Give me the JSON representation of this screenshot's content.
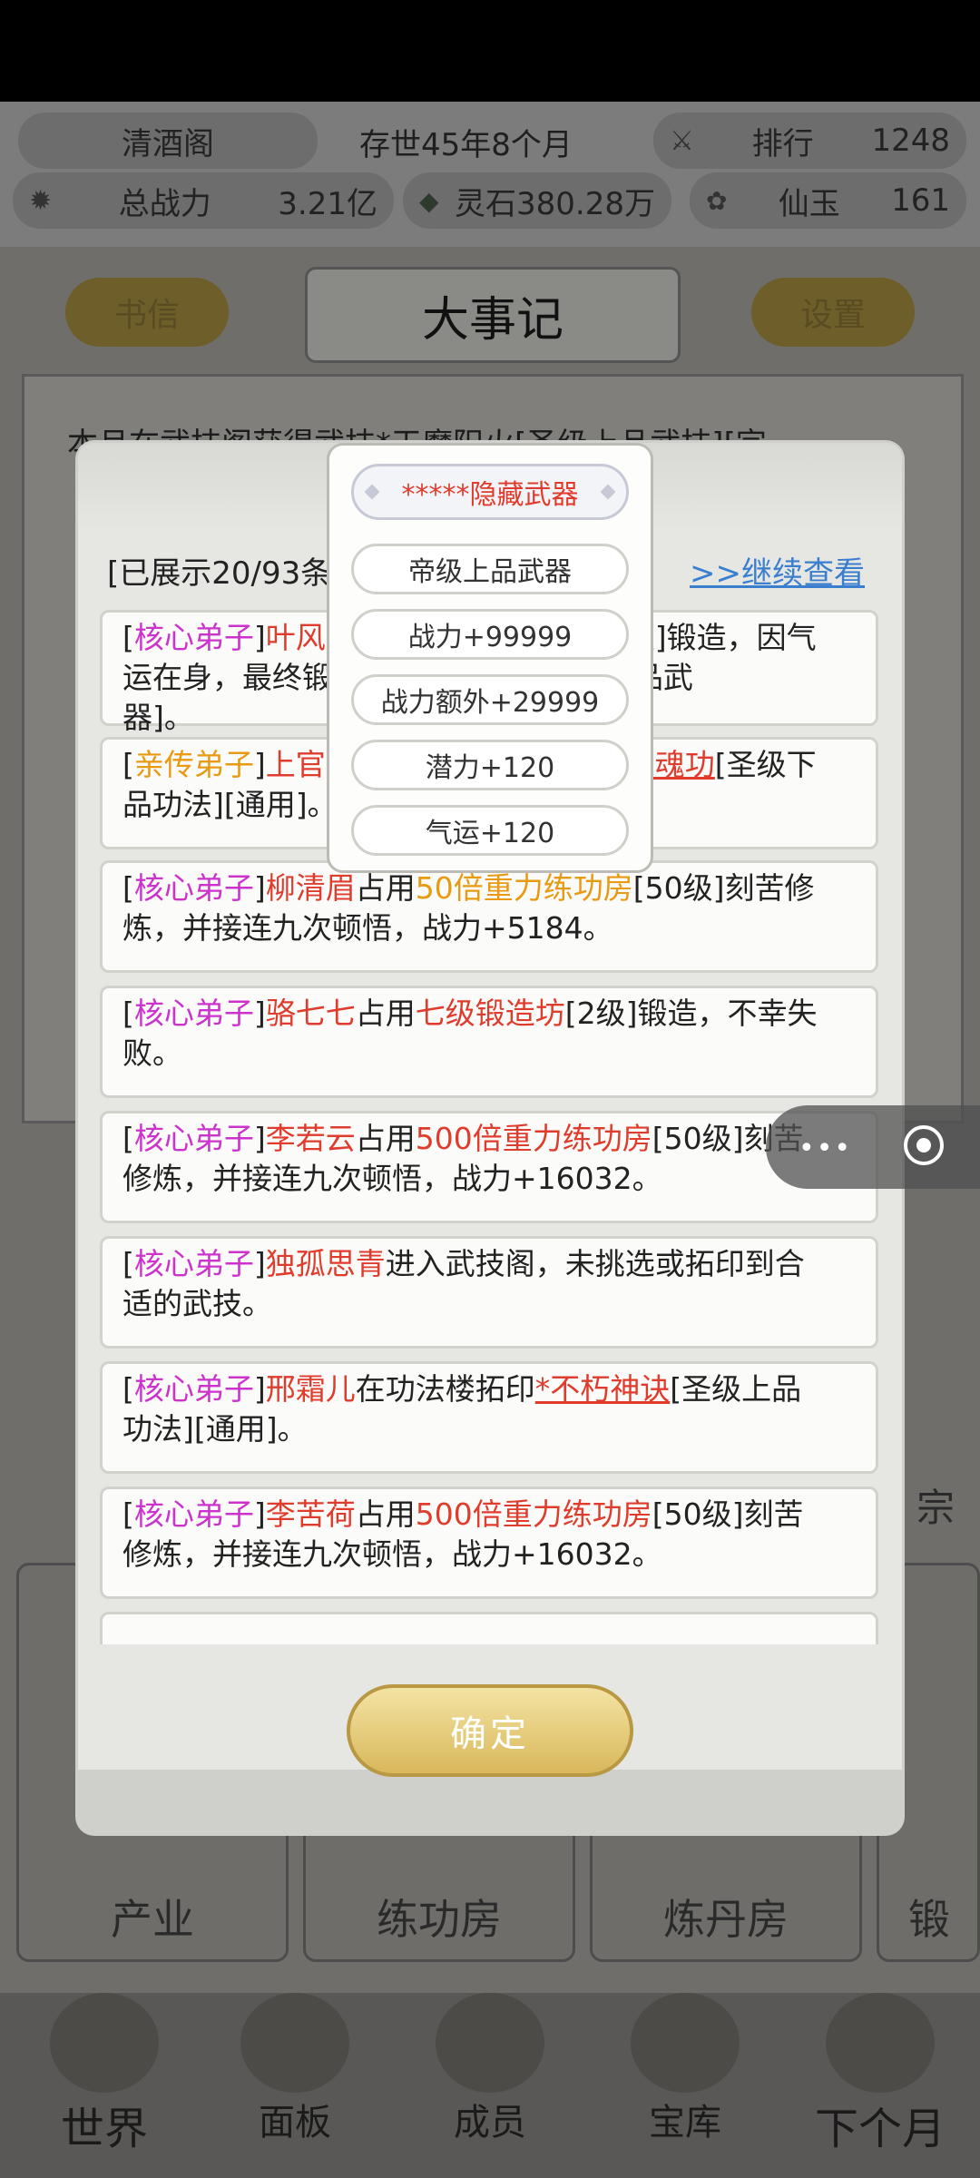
{
  "top": {
    "sect_name": "清酒阁",
    "existence": "存世45年8个月",
    "rank_label": "排行",
    "rank_value": "1248",
    "power_label": "总战力",
    "power_value": "3.21亿",
    "spirit_stone": "灵石380.28万",
    "immortal_jade_label": "仙玉",
    "immortal_jade_value": "161"
  },
  "header": {
    "letters_button": "书信",
    "title": "大事记",
    "settings_button": "设置"
  },
  "background": {
    "event_line1": "本月在武技阁获得武技*天魔阳火[圣级上品武技][宗",
    "side_char": "宗"
  },
  "facilities": [
    "产业",
    "练功房",
    "炼丹房",
    "锻"
  ],
  "nav": [
    "世界",
    "面板",
    "成员",
    "宝库",
    "下个月"
  ],
  "dialog": {
    "counter": "[已展示20/93条",
    "more_link": ">>继续查看",
    "confirm": "确定",
    "entries": [
      {
        "role": "核心弟子",
        "name": "叶风",
        "tail_a": "级]锻造，因气",
        "line2": "运在身，最终锻",
        "line2b": "[帝级上品武",
        "line3": "器]。"
      },
      {
        "role": "亲传弟子",
        "name": "上官",
        "item": "炼魂功",
        "tail_a": "[圣级下",
        "line2": "品功法][通用]。"
      },
      {
        "role": "核心弟子",
        "name": "柳清眉",
        "mid": "占用",
        "facility": "50倍重力练功房",
        "tail_a": "[50级]刻苦修",
        "line2": "炼，并接连九次顿悟，战力+5184。"
      },
      {
        "role": "核心弟子",
        "name": "骆七七",
        "mid": "占用",
        "facility": "七级锻造坊",
        "tail_a": "[2级]锻造，不幸失",
        "line2": "败。"
      },
      {
        "role": "核心弟子",
        "name": "李若云",
        "mid": "占用",
        "facility": "500倍重力练功房",
        "tail_a": "[50级]刻苦",
        "line2": "修炼，并接连九次顿悟，战力+16032。"
      },
      {
        "role": "核心弟子",
        "name": "独孤思青",
        "tail_a": "进入武技阁，未挑选或拓印到合",
        "line2": "适的武技。"
      },
      {
        "role": "核心弟子",
        "name": "邢霜儿",
        "mid": "在功法楼拓印",
        "item": "*不朽神诀",
        "tail_a": "[圣级上品",
        "line2": "功法][通用]。"
      },
      {
        "role": "核心弟子",
        "name": "李苦荷",
        "mid": "占用",
        "facility": "500倍重力练功房",
        "tail_a": "[50级]刻苦",
        "line2": "修炼，并接连九次顿悟，战力+16032。"
      }
    ]
  },
  "popup": {
    "name": "*****隐藏武器",
    "grade": "帝级上品武器",
    "power": "战力+99999",
    "extra_power": "战力额外+29999",
    "potential": "潜力+120",
    "luck": "气运+120"
  },
  "colors": {
    "core_disciple": "#cc33cc",
    "direct_disciple": "#e89a12",
    "name_red": "#e03c2d",
    "link_blue": "#3a7fcf",
    "button_gold": "#d9b85b"
  }
}
